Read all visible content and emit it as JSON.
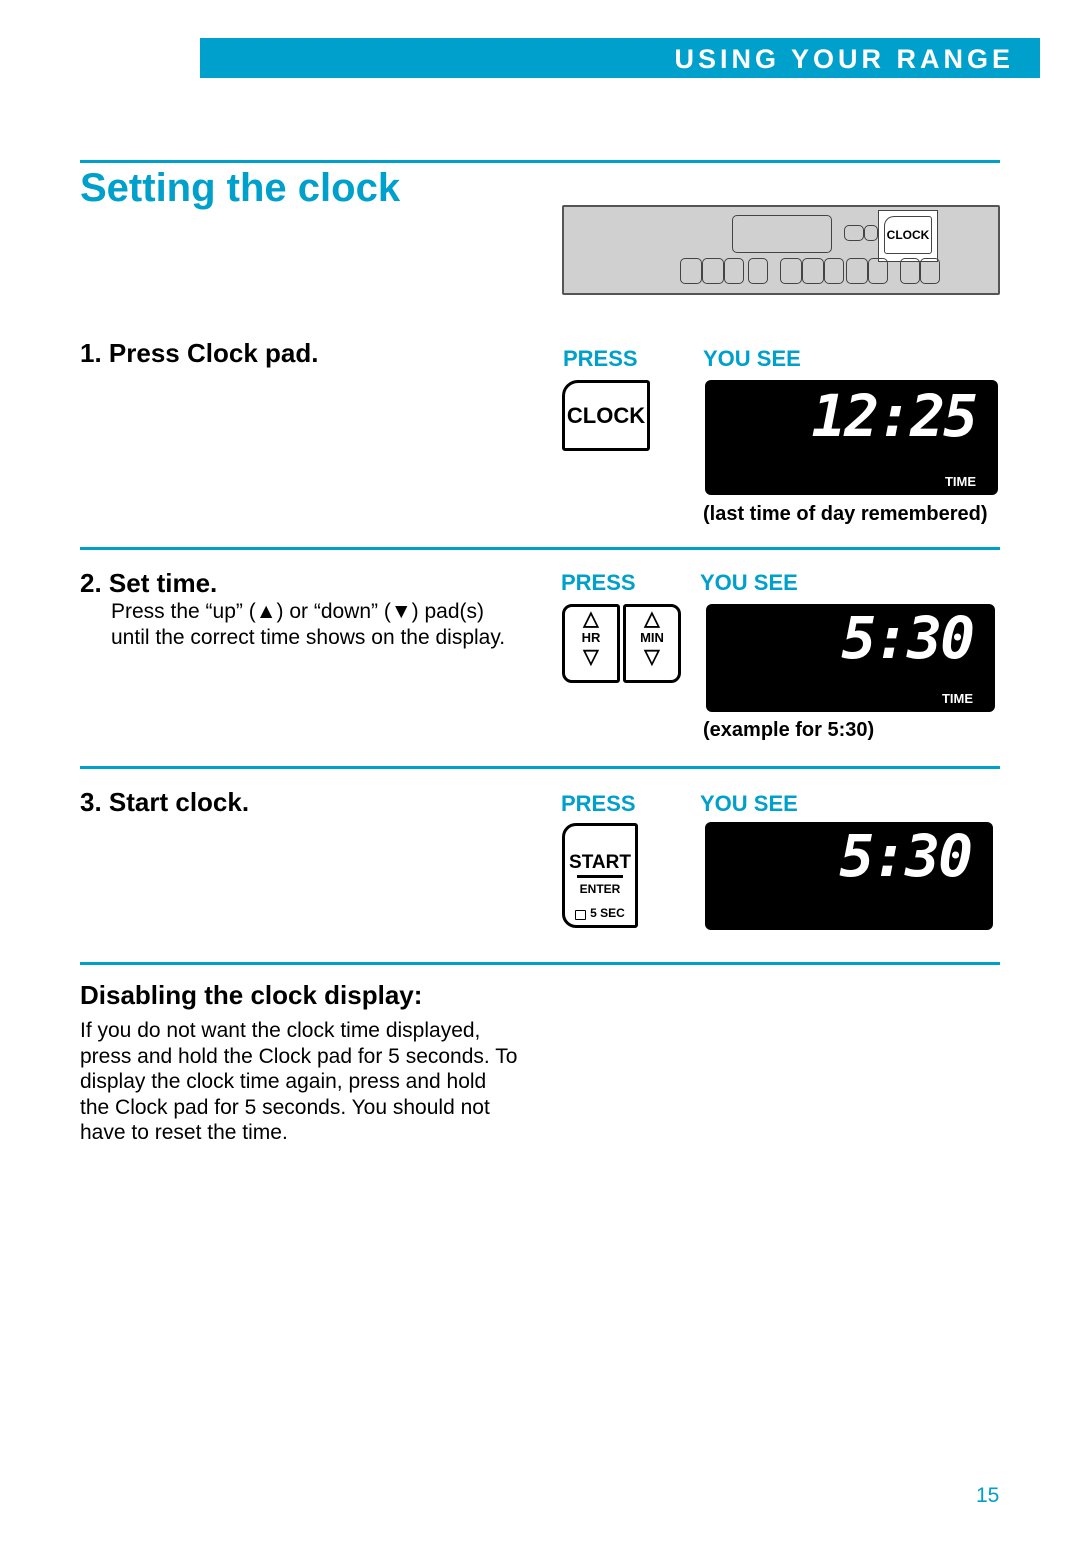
{
  "header": {
    "section": "USING YOUR RANGE"
  },
  "title": "Setting the clock",
  "panel": {
    "clock_key": "CLOCK"
  },
  "columns": {
    "press": "PRESS",
    "you_see": "YOU SEE"
  },
  "steps": [
    {
      "heading": "1. Press Clock pad.",
      "pad": "CLOCK",
      "display": "12:25",
      "display_label": "TIME",
      "note": "(last time of day remembered)"
    },
    {
      "heading": "2. Set time.",
      "body": "Press the “up” (▲) or “down” (▼) pad(s) until the correct time shows on the display.",
      "pad_hr": "HR",
      "pad_min": "MIN",
      "display": "5:30",
      "display_label": "TIME",
      "note": "(example for 5:30)"
    },
    {
      "heading": "3. Start clock.",
      "pad_start": "START",
      "pad_enter": "ENTER",
      "pad_lock": "5 SEC",
      "display": "5:30"
    }
  ],
  "disable": {
    "heading": "Disabling the clock display:",
    "body": "If you do not want the clock time displayed, press and hold the Clock pad for 5 seconds. To display the clock time again, press and hold the Clock pad for 5 seconds. You should not have to reset the time."
  },
  "page_number": "15",
  "colors": {
    "accent": "#00a0cc"
  }
}
